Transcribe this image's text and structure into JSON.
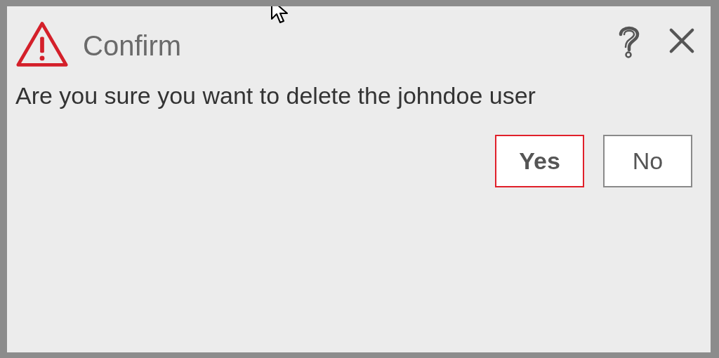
{
  "dialog": {
    "title": "Confirm",
    "message": "Are you sure you want to delete the johndoe user"
  },
  "buttons": [
    {
      "label": "Yes",
      "focused": true
    },
    {
      "label": "No",
      "focused": false
    }
  ]
}
